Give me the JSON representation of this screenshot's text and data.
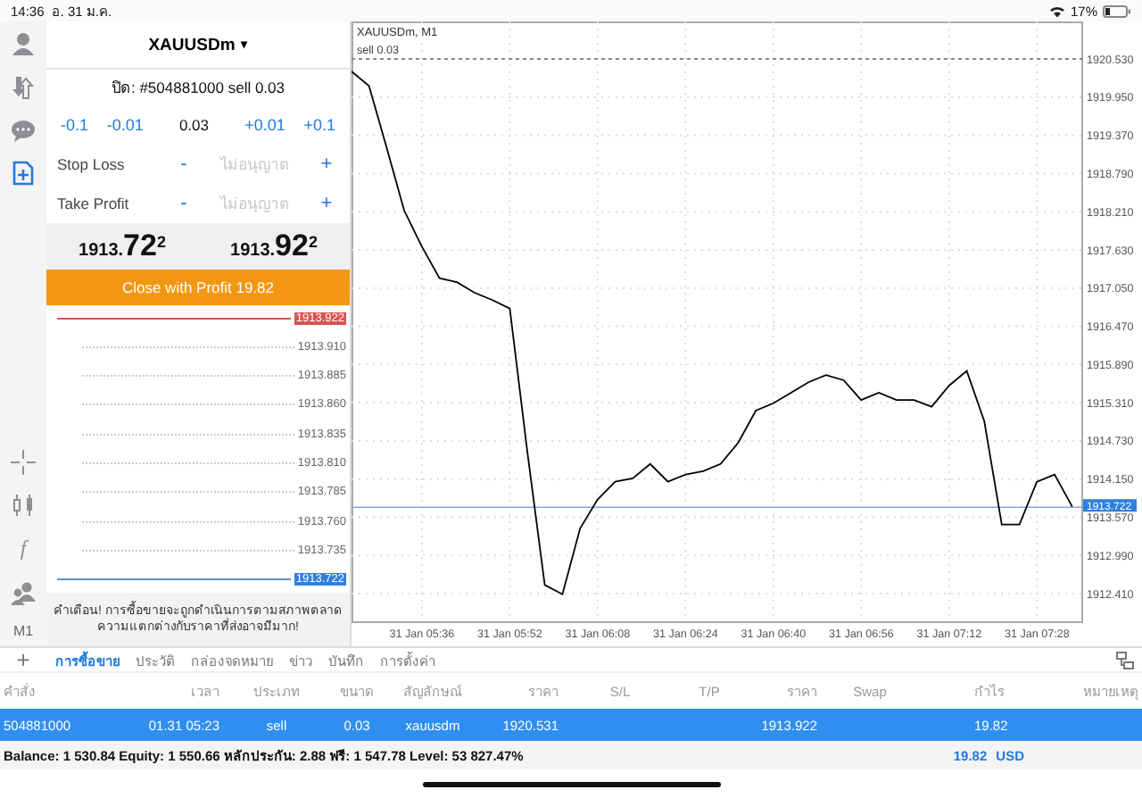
{
  "status_bar": {
    "time": "14:36",
    "date": "อ. 31 ม.ค.",
    "battery": "17%"
  },
  "rail": {
    "function_glyph": "f",
    "timeframe": "M1"
  },
  "order": {
    "symbol": "XAUUSDm",
    "caret": "▾",
    "title": "ปิด: #504881000 sell 0.03",
    "volume": {
      "minus": [
        "-0.1",
        "-0.01"
      ],
      "value": "0.03",
      "plus": [
        "+0.01",
        "+0.1"
      ]
    },
    "levels": [
      {
        "label": "Stop Loss",
        "minus": "-",
        "placeholder": "ไม่อนุญาต",
        "plus": "+"
      },
      {
        "label": "Take Profit",
        "minus": "-",
        "placeholder": "ไม่อนุญาต",
        "plus": "+"
      }
    ],
    "bid": "1913.**72**$^{2}$",
    "ask": "1913.**92**$^{2}$",
    "close_button": "Close with Profit 19.82",
    "ladder": {
      "ask": "1913.922",
      "levels": [
        "1913.910",
        "1913.885",
        "1913.860",
        "1913.835",
        "1913.810",
        "1913.785",
        "1913.760",
        "1913.735"
      ],
      "bid": "1913.722"
    },
    "warning": "คำเตือน! การซื้อขายจะถูกดำเนินการตามสภาพตลาด ความแตกต่างกับราคาที่ส่งอาจมีมาก!"
  },
  "chart": {
    "title": "XAUUSDm, M1",
    "chart_data": {
      "type": "line",
      "grid": true,
      "categories": [
        null,
        null,
        null,
        null,
        "31 Jan 05:36",
        null,
        null,
        null,
        null,
        "31 Jan 05:52",
        null,
        null,
        null,
        null,
        "31 Jan 06:08",
        null,
        null,
        null,
        null,
        "31 Jan 06:24",
        null,
        null,
        null,
        null,
        "31 Jan 06:40",
        null,
        null,
        null,
        null,
        "31 Jan 06:56",
        null,
        null,
        null,
        null,
        "31 Jan 07:12",
        null,
        null,
        null,
        null,
        "31 Jan 07:28",
        null,
        null
      ],
      "series": [
        {
          "color": "#000000",
          "values": [
            1920.34,
            1920.12,
            1919.18,
            1918.23,
            1917.68,
            1917.2,
            1917.14,
            1916.98,
            1916.87,
            1916.74,
            1914.57,
            1912.54,
            1912.4,
            1913.4,
            1913.84,
            1914.11,
            1914.16,
            1914.38,
            1914.11,
            1914.22,
            1914.27,
            1914.38,
            1914.7,
            1915.19,
            1915.3,
            1915.46,
            1915.62,
            1915.73,
            1915.65,
            1915.35,
            1915.46,
            1915.35,
            1915.35,
            1915.25,
            1915.57,
            1915.79,
            1915.03,
            1913.46,
            1913.46,
            1914.11,
            1914.22,
            1913.73
          ]
        }
      ],
      "ylim": [
        1911.99,
        1921.1
      ],
      "yticks": [
        {
          "value": 1920.53,
          "label": "1920.530"
        },
        {
          "value": 1919.95,
          "label": "1919.950"
        },
        {
          "value": 1919.37,
          "label": "1919.370"
        },
        {
          "value": 1918.79,
          "label": "1918.790"
        },
        {
          "value": 1918.21,
          "label": "1918.210"
        },
        {
          "value": 1917.63,
          "label": "1917.630"
        },
        {
          "value": 1917.05,
          "label": "1917.050"
        },
        {
          "value": 1916.47,
          "label": "1916.470"
        },
        {
          "value": 1915.89,
          "label": "1915.890"
        },
        {
          "value": 1915.31,
          "label": "1915.310"
        },
        {
          "value": 1914.73,
          "label": "1914.730"
        },
        {
          "value": 1914.15,
          "label": "1914.150"
        },
        {
          "value": 1913.57,
          "label": "1913.570"
        },
        {
          "value": 1912.99,
          "label": "1912.990"
        },
        {
          "value": 1912.41,
          "label": "1912.410"
        }
      ],
      "ref_lines": [
        {
          "axis": "y",
          "value": 1920.53,
          "label": "sell 0.03",
          "color": "#888888"
        },
        {
          "axis": "y",
          "value": 1913.722,
          "label": "1913.722",
          "color": "#8aa6d6"
        }
      ]
    }
  },
  "terminal": {
    "add": "+",
    "tabs": [
      {
        "label": "การซื้อขาย",
        "selected": true
      },
      {
        "label": "ประวัติ",
        "selected": false
      },
      {
        "label": "กล่องจดหมาย",
        "selected": false
      },
      {
        "label": "ข่าว",
        "selected": false
      },
      {
        "label": "บันทึก",
        "selected": false
      },
      {
        "label": "การตั้งค่า",
        "selected": false
      }
    ],
    "columns": [
      "คำสั่ง",
      "เวลา",
      "ประเภท",
      "ขนาด",
      "สัญลักษณ์",
      "ราคา",
      "S/L",
      "T/P",
      "ราคา",
      "Swap",
      "กำไร",
      "หมายเหตุ"
    ],
    "rows": [
      {
        "selected": true,
        "cells": [
          "504881000",
          "01.31 05:23",
          "sell",
          "0.03",
          "xauusdm",
          "1920.531",
          null,
          null,
          "1913.922",
          null,
          "19.82",
          null
        ]
      }
    ],
    "summary": {
      "text": "Balance: 1 530.84 Equity: 1 550.66 หลักประกัน: 2.88 ฟรี: 1 547.78 Level: 53 827.47%",
      "profit": "19.82",
      "currency": "USD"
    }
  }
}
